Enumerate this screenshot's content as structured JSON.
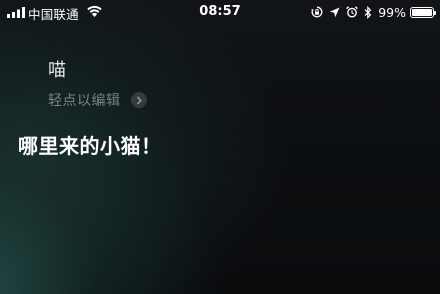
{
  "status_bar": {
    "carrier": "中国联通",
    "time": "08:57",
    "battery_percent": "99%",
    "battery_level": 0.99,
    "icons": [
      "signal-icon",
      "wifi-icon",
      "rotation-lock-icon",
      "location-arrow-icon",
      "alarm-icon",
      "bluetooth-icon",
      "battery-icon"
    ]
  },
  "siri": {
    "query": "喵",
    "edit_hint": "轻点以编辑",
    "response": "哪里来的小猫！"
  },
  "colors": {
    "text_primary": "#ffffff",
    "text_secondary": "#7c8284",
    "background_glow": "#2e6e64"
  }
}
